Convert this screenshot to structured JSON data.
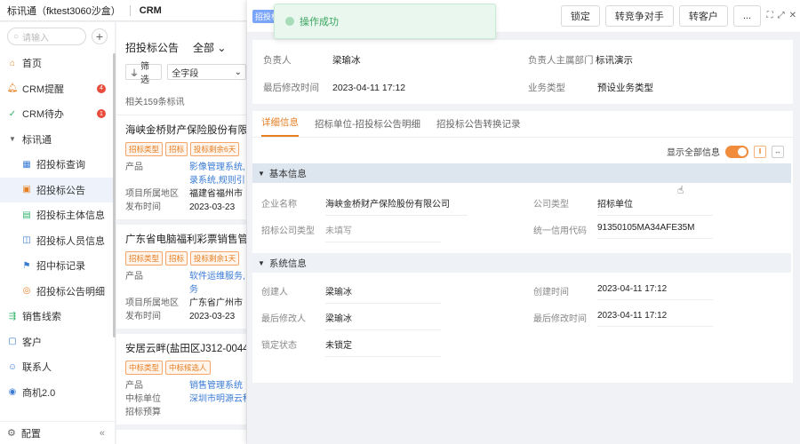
{
  "topbar": {
    "app_name": "标讯通（fktest3060沙盒）",
    "module": "CRM"
  },
  "sidebar": {
    "search_placeholder": "请输入",
    "items": [
      {
        "label": "首页",
        "icon": "home-icon"
      },
      {
        "label": "CRM提醒",
        "icon": "bell-icon",
        "badge": "4"
      },
      {
        "label": "CRM待办",
        "icon": "check-circle-icon",
        "badge": "1"
      },
      {
        "label": "标讯通",
        "icon": "caret-down-icon"
      },
      {
        "label": "招投标查询",
        "icon": "chart-icon"
      },
      {
        "label": "招投标公告",
        "icon": "announce-icon"
      },
      {
        "label": "招投标主体信息",
        "icon": "building-icon"
      },
      {
        "label": "招投标人员信息",
        "icon": "person-icon"
      },
      {
        "label": "招中标记录",
        "icon": "flag-icon"
      },
      {
        "label": "招投标公告明细",
        "icon": "detail-icon"
      },
      {
        "label": "销售线索",
        "icon": "lead-icon"
      },
      {
        "label": "客户",
        "icon": "customer-icon"
      },
      {
        "label": "联系人",
        "icon": "contact-icon"
      },
      {
        "label": "商机2.0",
        "icon": "opportunity-icon"
      }
    ],
    "footer_label": "配置"
  },
  "list": {
    "title": "招投标公告",
    "view": "全部",
    "filter_label": "筛选",
    "field_select": "全字段",
    "count": "相关159条标讯",
    "cards": [
      {
        "title": "海峡金桥财产保险股份有限公司",
        "tags": [
          "招标类型",
          "招标",
          "投标剩余6天"
        ],
        "rows": [
          {
            "k": "产品",
            "v": "影像管理系统,",
            "link": true
          },
          {
            "k": "",
            "v": "录系统,规则引",
            "link": true
          },
          {
            "k": "项目所属地区",
            "v": "福建省福州市",
            "link": false
          },
          {
            "k": "发布时间",
            "v": "2023-03-23",
            "link": false
          }
        ]
      },
      {
        "title": "广东省电脑福利彩票销售管理",
        "tags": [
          "招标类型",
          "招标",
          "投标剩余1天"
        ],
        "rows": [
          {
            "k": "产品",
            "v": "软件运维服务,",
            "link": true
          },
          {
            "k": "",
            "v": "务",
            "link": true
          },
          {
            "k": "项目所属地区",
            "v": "广东省广州市",
            "link": false
          },
          {
            "k": "发布时间",
            "v": "2023-03-23",
            "link": false
          }
        ]
      },
      {
        "title": "安居云畔(盐田区J312-0044地",
        "tags": [
          "中标类型",
          "中标候选人"
        ],
        "rows": [
          {
            "k": "产品",
            "v": "销售管理系统",
            "link": true
          },
          {
            "k": "中标单位",
            "v": "深圳市明源云科",
            "link": true
          },
          {
            "k": "招标预算",
            "v": "",
            "link": false
          }
        ]
      }
    ]
  },
  "drawer": {
    "head_tag": "招投标",
    "toast": "操作成功",
    "actions": [
      "锁定",
      "转竞争对手",
      "转客户",
      "..."
    ],
    "summary": {
      "owner_label": "负责人",
      "owner": "梁瑜冰",
      "dept_label": "负责人主属部门",
      "dept": "标讯演示",
      "modified_label": "最后修改时间",
      "modified": "2023-04-11 17:12",
      "biztype_label": "业务类型",
      "biztype": "预设业务类型"
    },
    "tabs": [
      "详细信息",
      "招标单位-招投标公告明细",
      "招投标公告转换记录"
    ],
    "show_all": "显示全部信息",
    "basic": {
      "title": "基本信息",
      "company_label": "企业名称",
      "company": "海峡金桥财产保险股份有限公司",
      "ctype_label": "公司类型",
      "ctype": "招标单位",
      "tender_type_label": "招标公司类型",
      "tender_type": "未填写",
      "credit_label": "统一信用代码",
      "credit": "91350105MA34AFE35M"
    },
    "system": {
      "title": "系统信息",
      "creator_label": "创建人",
      "creator": "梁瑜冰",
      "created_label": "创建时间",
      "created": "2023-04-11 17:12",
      "modifier_label": "最后修改人",
      "modifier": "梁瑜冰",
      "modified_label": "最后修改时间",
      "modified": "2023-04-11 17:12",
      "lock_label": "锁定状态",
      "lock": "未锁定"
    }
  }
}
